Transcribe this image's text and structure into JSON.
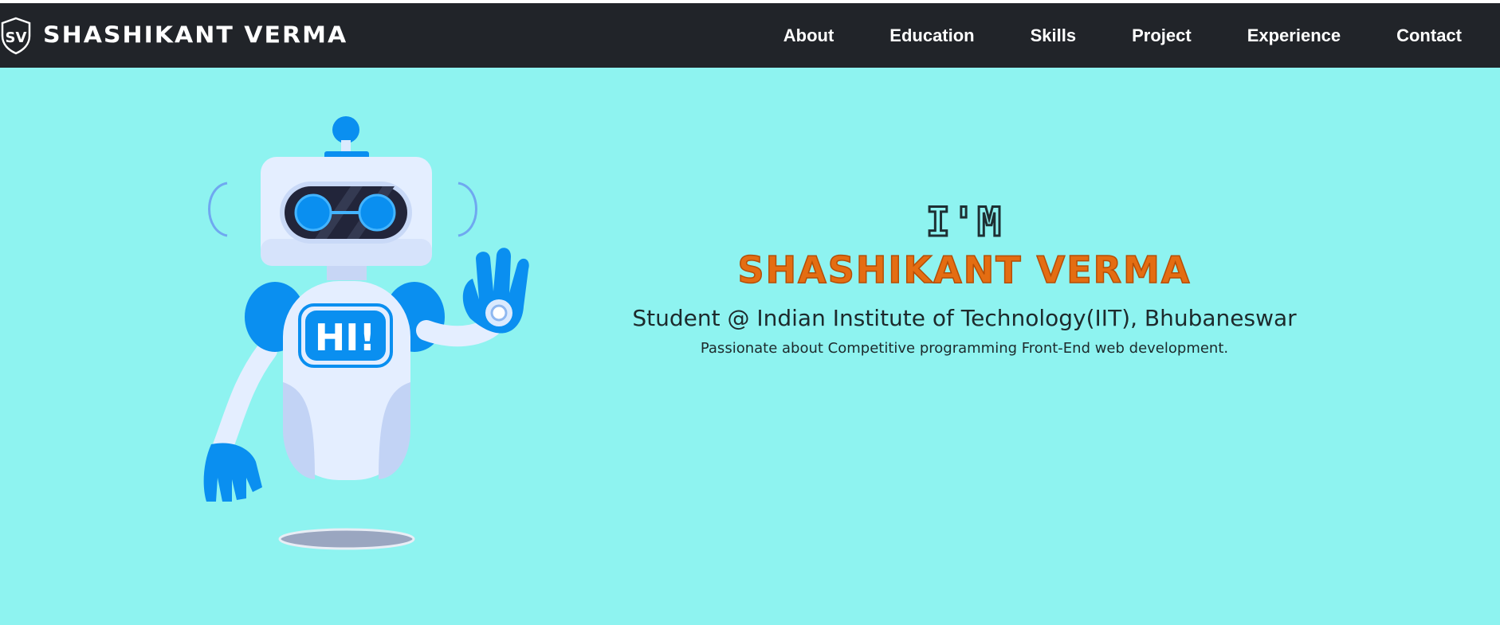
{
  "navbar": {
    "brand_name": "SHASHIKANT VERMA",
    "logo_text": "SV",
    "links": [
      "About",
      "Education",
      "Skills",
      "Project",
      "Experience",
      "Contact"
    ]
  },
  "hero": {
    "greeting": "I'M",
    "name": "SHASHIKANT VERMA",
    "subtitle": "Student @ Indian Institute of Technology(IIT), Bhubaneswar",
    "description": "Passionate about Competitive programming Front-End web development.",
    "robot_badge": "HI!"
  },
  "colors": {
    "navbar_bg": "#212429",
    "hero_bg": "#8ef3f0",
    "name_accent": "#e46d12",
    "robot_blue": "#0a8ff0"
  }
}
